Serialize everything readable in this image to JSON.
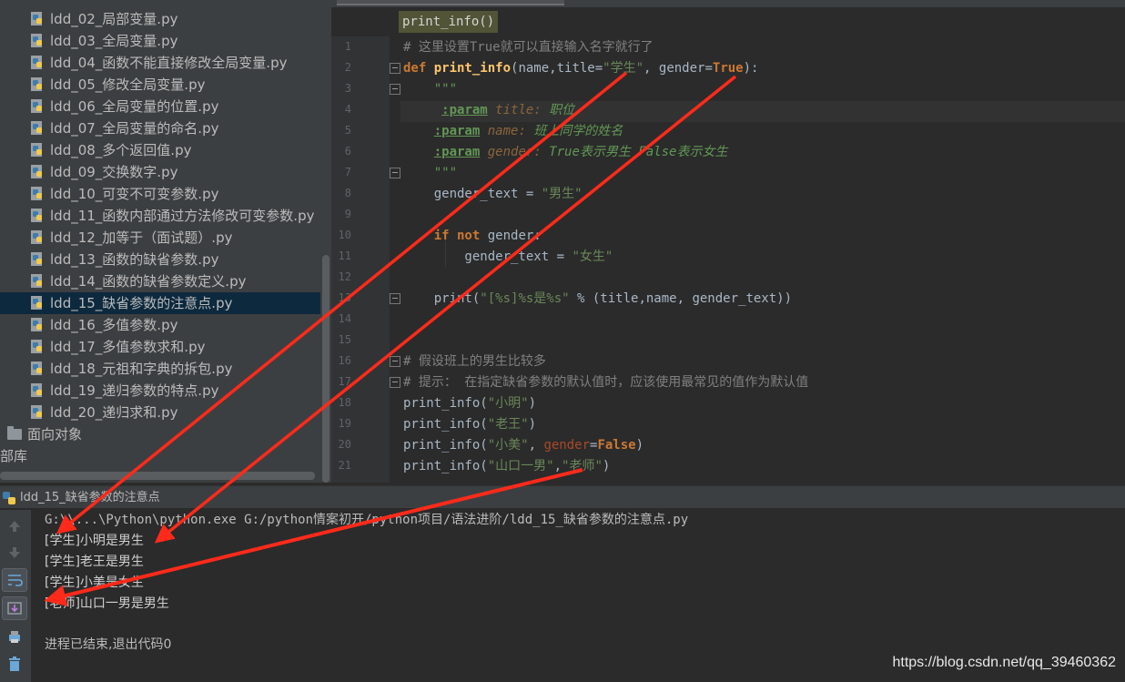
{
  "project_tree": {
    "files": [
      "ldd_02_局部变量.py",
      "ldd_03_全局变量.py",
      "ldd_04_函数不能直接修改全局变量.py",
      "ldd_05_修改全局变量.py",
      "ldd_06_全局变量的位置.py",
      "ldd_07_全局变量的命名.py",
      "ldd_08_多个返回值.py",
      "ldd_09_交换数字.py",
      "ldd_10_可变不可变参数.py",
      "ldd_11_函数内部通过方法修改可变参数.py",
      "ldd_12_加等于（面试题）.py",
      "ldd_13_函数的缺省参数.py",
      "ldd_14_函数的缺省参数定义.py",
      "ldd_15_缺省参数的注意点.py",
      "ldd_16_多值参数.py",
      "ldd_17_多值参数求和.py",
      "ldd_18_元祖和字典的拆包.py",
      "ldd_19_递归参数的特点.py",
      "ldd_20_递归求和.py"
    ],
    "selected_index": 13,
    "folder": "面向对象",
    "partial_item": "部库"
  },
  "editor": {
    "breadcrumb": "print_info()",
    "line_numbers": [
      "1",
      "2",
      "3",
      "4",
      "5",
      "6",
      "7",
      "8",
      "9",
      "10",
      "11",
      "12",
      "13",
      "14",
      "15",
      "16",
      "17",
      "18",
      "19",
      "20",
      "21"
    ],
    "lines": [
      [
        {
          "t": "# 这里设置True就可以直接输入名字就行了",
          "c": "comment"
        }
      ],
      [
        {
          "t": "def ",
          "c": "kw"
        },
        {
          "t": "print_info",
          "c": "fn"
        },
        {
          "t": "(name,title=",
          "c": "plain"
        },
        {
          "t": "\"学生\"",
          "c": "str"
        },
        {
          "t": ", gender=",
          "c": "plain"
        },
        {
          "t": "True",
          "c": "kw"
        },
        {
          "t": "):",
          "c": "plain"
        }
      ],
      [
        {
          "t": "    \"\"\"",
          "c": "doc"
        }
      ],
      [
        {
          "t": "     ",
          "c": "plain"
        },
        {
          "t": ":param",
          "c": "doctag"
        },
        {
          "t": " title: ",
          "c": "docparam"
        },
        {
          "t": "职位",
          "c": "doc"
        }
      ],
      [
        {
          "t": "    ",
          "c": "plain"
        },
        {
          "t": ":param",
          "c": "doctag"
        },
        {
          "t": " name: ",
          "c": "docparam"
        },
        {
          "t": "班上同学的姓名",
          "c": "doc"
        }
      ],
      [
        {
          "t": "    ",
          "c": "plain"
        },
        {
          "t": ":param",
          "c": "doctag"
        },
        {
          "t": " gender: ",
          "c": "docparam"
        },
        {
          "t": "True表示男生 False表示女生",
          "c": "doc"
        }
      ],
      [
        {
          "t": "    \"\"\"",
          "c": "doc"
        }
      ],
      [
        {
          "t": "    gender_text = ",
          "c": "plain"
        },
        {
          "t": "\"男生\"",
          "c": "str"
        }
      ],
      [],
      [
        {
          "t": "    ",
          "c": "plain"
        },
        {
          "t": "if not ",
          "c": "kw"
        },
        {
          "t": "gender:",
          "c": "plain"
        }
      ],
      [
        {
          "t": "        gender_text = ",
          "c": "plain"
        },
        {
          "t": "\"女生\"",
          "c": "str"
        }
      ],
      [],
      [
        {
          "t": "    print(",
          "c": "plain"
        },
        {
          "t": "\"[%s]%s是%s\"",
          "c": "str"
        },
        {
          "t": " % (title,name, gender_text))",
          "c": "plain"
        }
      ],
      [],
      [],
      [
        {
          "t": "# 假设班上的男生比较多",
          "c": "comment"
        }
      ],
      [
        {
          "t": "# 提示： 在指定缺省参数的默认值时，应该使用最常见的值作为默认值",
          "c": "comment"
        }
      ],
      [
        {
          "t": "print_info(",
          "c": "plain"
        },
        {
          "t": "\"小明\"",
          "c": "str"
        },
        {
          "t": ")",
          "c": "plain"
        }
      ],
      [
        {
          "t": "print_info(",
          "c": "plain"
        },
        {
          "t": "\"老王\"",
          "c": "str"
        },
        {
          "t": ")",
          "c": "plain"
        }
      ],
      [
        {
          "t": "print_info(",
          "c": "plain"
        },
        {
          "t": "\"小美\"",
          "c": "str"
        },
        {
          "t": ", ",
          "c": "plain"
        },
        {
          "t": "gender",
          "c": "named"
        },
        {
          "t": "=",
          "c": "plain"
        },
        {
          "t": "False",
          "c": "kw"
        },
        {
          "t": ")",
          "c": "plain"
        }
      ],
      [
        {
          "t": "print_info(",
          "c": "plain"
        },
        {
          "t": "\"山口一男\"",
          "c": "str"
        },
        {
          "t": ",",
          "c": "plain"
        },
        {
          "t": "\"老师\"",
          "c": "str"
        },
        {
          "t": ")",
          "c": "plain"
        }
      ]
    ]
  },
  "run": {
    "tab_label": "ldd_15_缺省参数的注意点",
    "command": "G:\\\\...\\Python\\python.exe G:/python情案初开/python项目/语法进阶/ldd_15_缺省参数的注意点.py",
    "output": [
      "[学生]小明是男生",
      "[学生]老王是男生",
      "[学生]小美是女生",
      "[老师]山口一男是男生"
    ],
    "exit_message": "进程已结束,退出代码0"
  },
  "watermark": "https://blog.csdn.net/qq_39460362",
  "colors": {
    "arrow": "#ff2a1a",
    "selection": "#0d293e",
    "editor_bg": "#2b2b2b",
    "panel_bg": "#3c3f41"
  },
  "icons": {
    "file": "python-file-icon",
    "folder": "folder-icon",
    "run_tab": "python-run-icon",
    "toolbar": [
      "arrow-up-icon",
      "arrow-down-icon",
      "soft-wrap-icon",
      "scroll-to-end-icon",
      "print-icon",
      "trash-icon"
    ]
  }
}
